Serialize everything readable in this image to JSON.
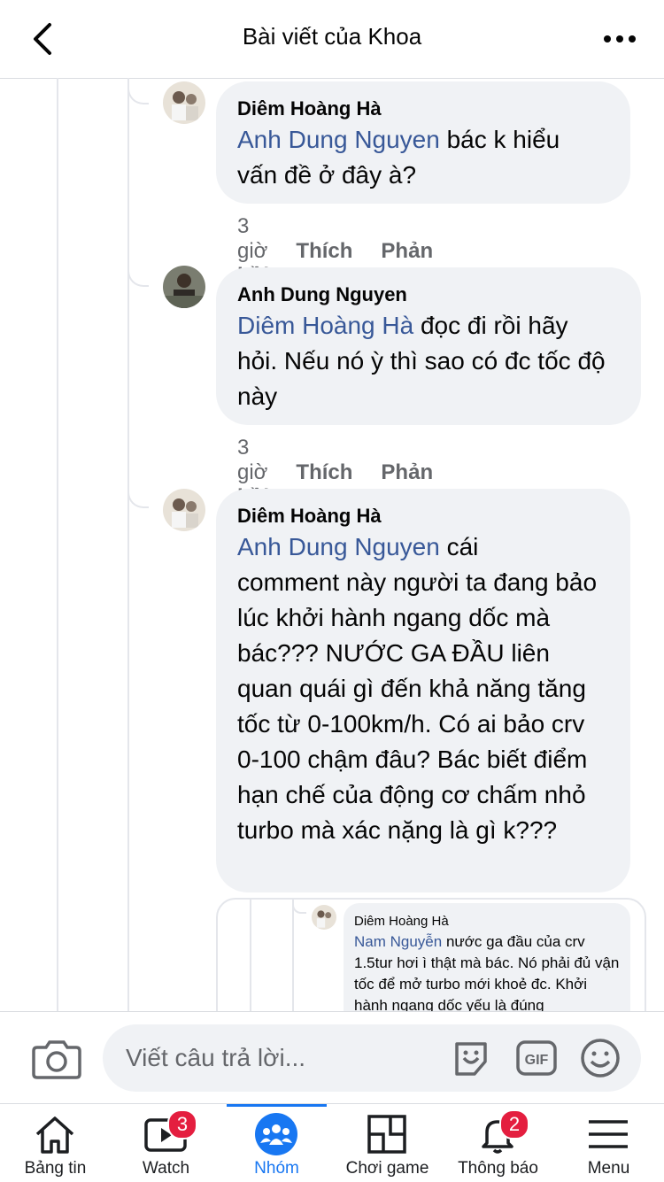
{
  "header": {
    "title": "Bài viết của Khoa"
  },
  "comments": [
    {
      "author": "Diêm Hoàng Hà",
      "mention": "Anh Dung Nguyen",
      "text_line1": " bác k hiểu",
      "text_rest": "vấn đề ở đây à?",
      "time": "3 giờ",
      "like": "Thích",
      "reply": "Phản hồi"
    },
    {
      "author": "Anh Dung Nguyen",
      "mention": "Diêm Hoàng Hà",
      "text_line1": " đọc đi rồi hãy",
      "text_rest": "hỏi. Nếu nó ỳ thì sao có đc tốc độ này",
      "time": "3 giờ",
      "like": "Thích",
      "reply": "Phản hồi"
    },
    {
      "author": "Diêm Hoàng Hà",
      "mention": "Anh Dung Nguyen",
      "text_line1": " cái",
      "text_rest": "comment này người ta đang bảo lúc khởi hành ngang dốc mà bác??? NƯỚC GA ĐẦU liên quan quái gì đến khả năng tăng tốc từ 0-100km/h. Có ai bảo crv 0-100 chậm đâu? Bác biết điểm hạn chế của động cơ chấm nhỏ turbo mà xác nặng là gì k???"
    }
  ],
  "embedded": {
    "author": "Diêm Hoàng Hà",
    "mention": "Nam Nguyễn",
    "text": " nước ga đầu của crv 1.5tur hơi ì thật mà bác. Nó phải đủ vận tốc để mở turbo mới khoẻ đc. Khởi hành ngang dốc yếu là đúng"
  },
  "composer": {
    "placeholder": "Viết câu trả lời..."
  },
  "tabs": [
    {
      "label": "Bảng tin",
      "icon": "home-icon"
    },
    {
      "label": "Watch",
      "icon": "watch-icon",
      "badge": "3"
    },
    {
      "label": "Nhóm",
      "icon": "groups-icon",
      "active": true
    },
    {
      "label": "Chơi game",
      "icon": "gaming-icon"
    },
    {
      "label": "Thông báo",
      "icon": "bell-icon",
      "badge": "2"
    },
    {
      "label": "Menu",
      "icon": "menu-icon"
    }
  ],
  "colors": {
    "accent": "#1877f2",
    "mention": "#385898",
    "bubble": "#f0f2f5",
    "badge": "#e41e3f"
  }
}
